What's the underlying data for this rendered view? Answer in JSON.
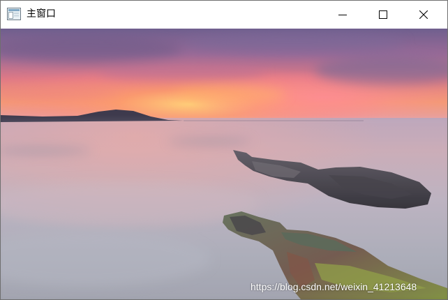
{
  "window": {
    "title": "主窗口",
    "icon": "app-window-icon",
    "controls": {
      "minimize": "minimize-icon",
      "maximize": "maximize-icon",
      "close": "close-icon"
    }
  },
  "content": {
    "image": "seascape-sunset-photo",
    "watermark": "https://blog.csdn.net/weixin_41213648"
  },
  "colors": {
    "titlebar_bg": "#ffffff",
    "window_border": "#6f6f6f",
    "title_text": "#000000"
  }
}
